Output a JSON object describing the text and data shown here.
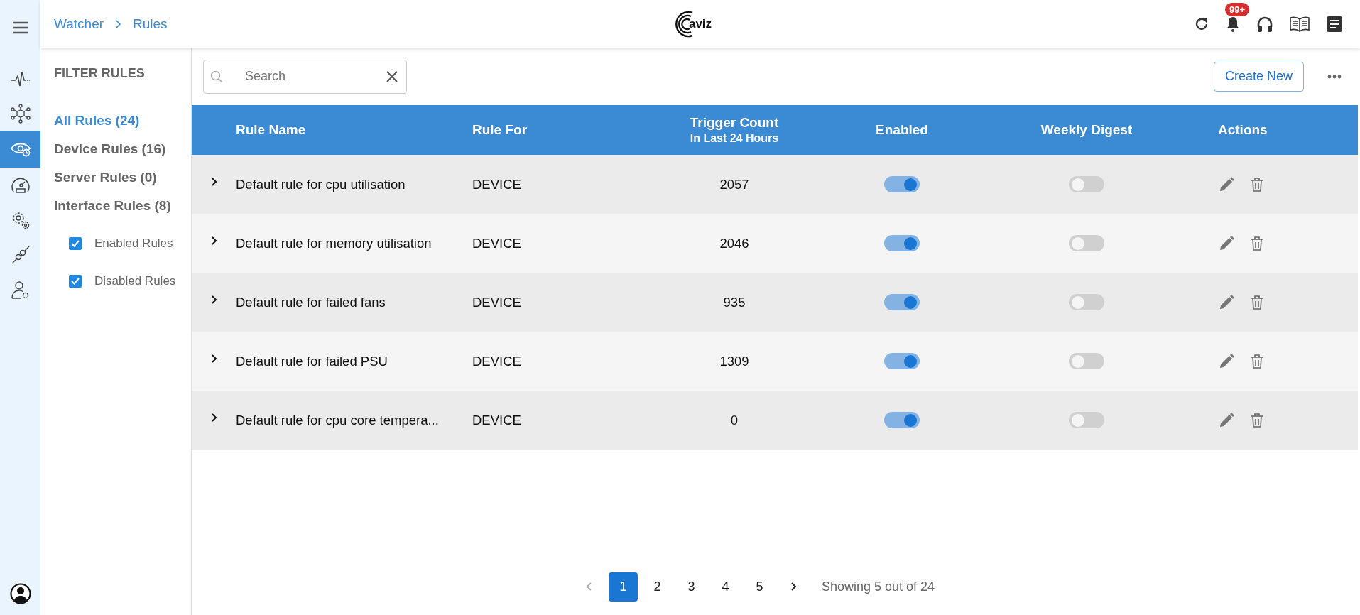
{
  "breadcrumb": [
    "Watcher",
    "Rules"
  ],
  "logo": {
    "text": "aviz"
  },
  "notifications": {
    "badge": "99+"
  },
  "rail": {
    "items": [
      {
        "selected": false
      },
      {
        "selected": false
      },
      {
        "selected": true
      },
      {
        "selected": false
      },
      {
        "selected": false
      },
      {
        "selected": false
      },
      {
        "selected": false
      }
    ]
  },
  "filter": {
    "title": "FILTER RULES",
    "items": [
      {
        "label": "All Rules (24)",
        "selected": true
      },
      {
        "label": "Device Rules (16)",
        "selected": false
      },
      {
        "label": "Server Rules (0)",
        "selected": false
      },
      {
        "label": "Interface Rules (8)",
        "selected": false
      }
    ],
    "checkboxes": [
      {
        "label": "Enabled Rules",
        "checked": true
      },
      {
        "label": "Disabled Rules",
        "checked": true
      }
    ]
  },
  "search": {
    "placeholder": "Search"
  },
  "create_button": "Create New",
  "table": {
    "columns": [
      "Rule Name",
      "Rule For",
      "Trigger Count",
      "Enabled",
      "Weekly Digest",
      "Actions"
    ],
    "trigger_subtitle": "In Last 24 Hours",
    "rows": [
      {
        "name": "Default rule for cpu utilisation",
        "rule_for": "DEVICE",
        "trigger_count": "2057",
        "enabled": true,
        "weekly_digest": false
      },
      {
        "name": "Default rule for memory utilisation",
        "rule_for": "DEVICE",
        "trigger_count": "2046",
        "enabled": true,
        "weekly_digest": false
      },
      {
        "name": "Default rule for failed fans",
        "rule_for": "DEVICE",
        "trigger_count": "935",
        "enabled": true,
        "weekly_digest": false
      },
      {
        "name": "Default rule for failed PSU",
        "rule_for": "DEVICE",
        "trigger_count": "1309",
        "enabled": true,
        "weekly_digest": false
      },
      {
        "name": "Default rule for cpu core tempera...",
        "rule_for": "DEVICE",
        "trigger_count": "0",
        "enabled": true,
        "weekly_digest": false
      }
    ]
  },
  "pagination": {
    "prev_disabled": true,
    "next_disabled": false,
    "pages": [
      {
        "label": "1",
        "selected": true
      },
      {
        "label": "2",
        "selected": false
      },
      {
        "label": "3",
        "selected": false
      },
      {
        "label": "4",
        "selected": false
      },
      {
        "label": "5",
        "selected": false
      }
    ],
    "summary": "Showing 5 out of 24"
  }
}
